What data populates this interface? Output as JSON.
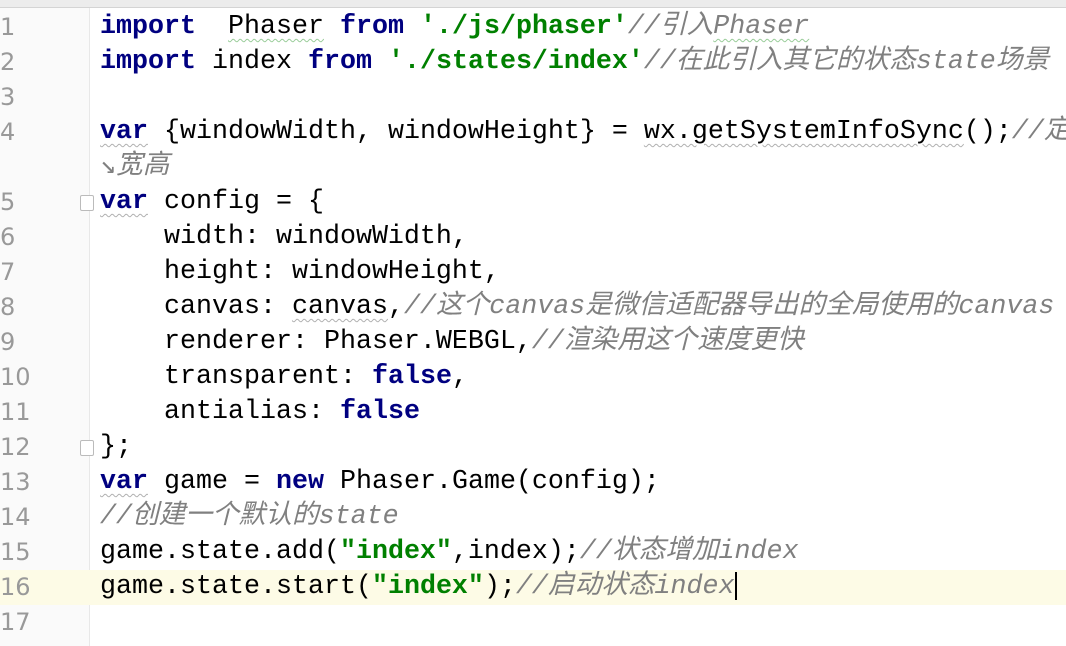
{
  "editor": {
    "current_line": 16,
    "colors": {
      "keyword": "#000080",
      "string": "#008000",
      "comment": "#808080",
      "line_number": "#999999",
      "current_line_bg": "#fdfbe6"
    },
    "rows": [
      {
        "ln": "1",
        "tokens": [
          [
            "kw",
            "import"
          ],
          [
            "",
            "  "
          ],
          [
            "sqg",
            "Phaser"
          ],
          [
            "",
            " "
          ],
          [
            "kw",
            "from"
          ],
          [
            "",
            " "
          ],
          [
            "str",
            "'./js/phaser'"
          ],
          [
            "cm",
            "//引入"
          ],
          [
            "cm sqg",
            "Phaser"
          ]
        ]
      },
      {
        "ln": "2",
        "tokens": [
          [
            "kw",
            "import"
          ],
          [
            "",
            " index "
          ],
          [
            "kw",
            "from"
          ],
          [
            "",
            " "
          ],
          [
            "str",
            "'./states/index'"
          ],
          [
            "cm",
            "//在此引入其它的状态state场景"
          ]
        ]
      },
      {
        "ln": "3",
        "tokens": []
      },
      {
        "ln": "4",
        "tokens": [
          [
            "kw sq",
            "var"
          ],
          [
            "",
            " {windowWidth, windowHeight} = "
          ],
          [
            "sq",
            "wx.getSystemInfoSync"
          ],
          [
            "",
            "();"
          ],
          [
            "cm",
            "//定"
          ]
        ]
      },
      {
        "ln": "",
        "tokens": [
          [
            "cm",
            "↘宽高"
          ]
        ]
      },
      {
        "ln": "5",
        "fold": true,
        "tokens": [
          [
            "kw sq",
            "var"
          ],
          [
            "",
            " config = {"
          ]
        ]
      },
      {
        "ln": "6",
        "tokens": [
          [
            "",
            "    width: windowWidth,"
          ]
        ]
      },
      {
        "ln": "7",
        "tokens": [
          [
            "",
            "    height: windowHeight,"
          ]
        ]
      },
      {
        "ln": "8",
        "tokens": [
          [
            "",
            "    canvas: "
          ],
          [
            "sq",
            "canvas"
          ],
          [
            "",
            ","
          ],
          [
            "cm",
            "//这个canvas是微信适配器导出的全局使用的canvas"
          ]
        ]
      },
      {
        "ln": "9",
        "tokens": [
          [
            "",
            "    renderer: Phaser.WEBGL,"
          ],
          [
            "cm",
            "//渲染用这个速度更快"
          ]
        ]
      },
      {
        "ln": "10",
        "tokens": [
          [
            "",
            "    transparent: "
          ],
          [
            "kw",
            "false"
          ],
          [
            "",
            ","
          ]
        ]
      },
      {
        "ln": "11",
        "tokens": [
          [
            "",
            "    antialias: "
          ],
          [
            "kw",
            "false"
          ]
        ]
      },
      {
        "ln": "12",
        "fold": true,
        "tokens": [
          [
            "",
            "};"
          ]
        ]
      },
      {
        "ln": "13",
        "tokens": [
          [
            "kw sq",
            "var"
          ],
          [
            "",
            " game = "
          ],
          [
            "kw",
            "new"
          ],
          [
            "",
            " Phaser.Game(config);"
          ]
        ]
      },
      {
        "ln": "14",
        "tokens": [
          [
            "cm",
            "//创建一个默认的state"
          ]
        ]
      },
      {
        "ln": "15",
        "tokens": [
          [
            "",
            "game.state.add("
          ],
          [
            "str",
            "\"index\""
          ],
          [
            "",
            ",index);"
          ],
          [
            "cm",
            "//状态增加index"
          ]
        ]
      },
      {
        "ln": "16",
        "current": true,
        "caret": true,
        "tokens": [
          [
            "",
            "game.state.start("
          ],
          [
            "str",
            "\"index\""
          ],
          [
            "",
            ");"
          ],
          [
            "cm",
            "//启动状态index"
          ]
        ]
      },
      {
        "ln": "17",
        "tokens": []
      }
    ]
  }
}
